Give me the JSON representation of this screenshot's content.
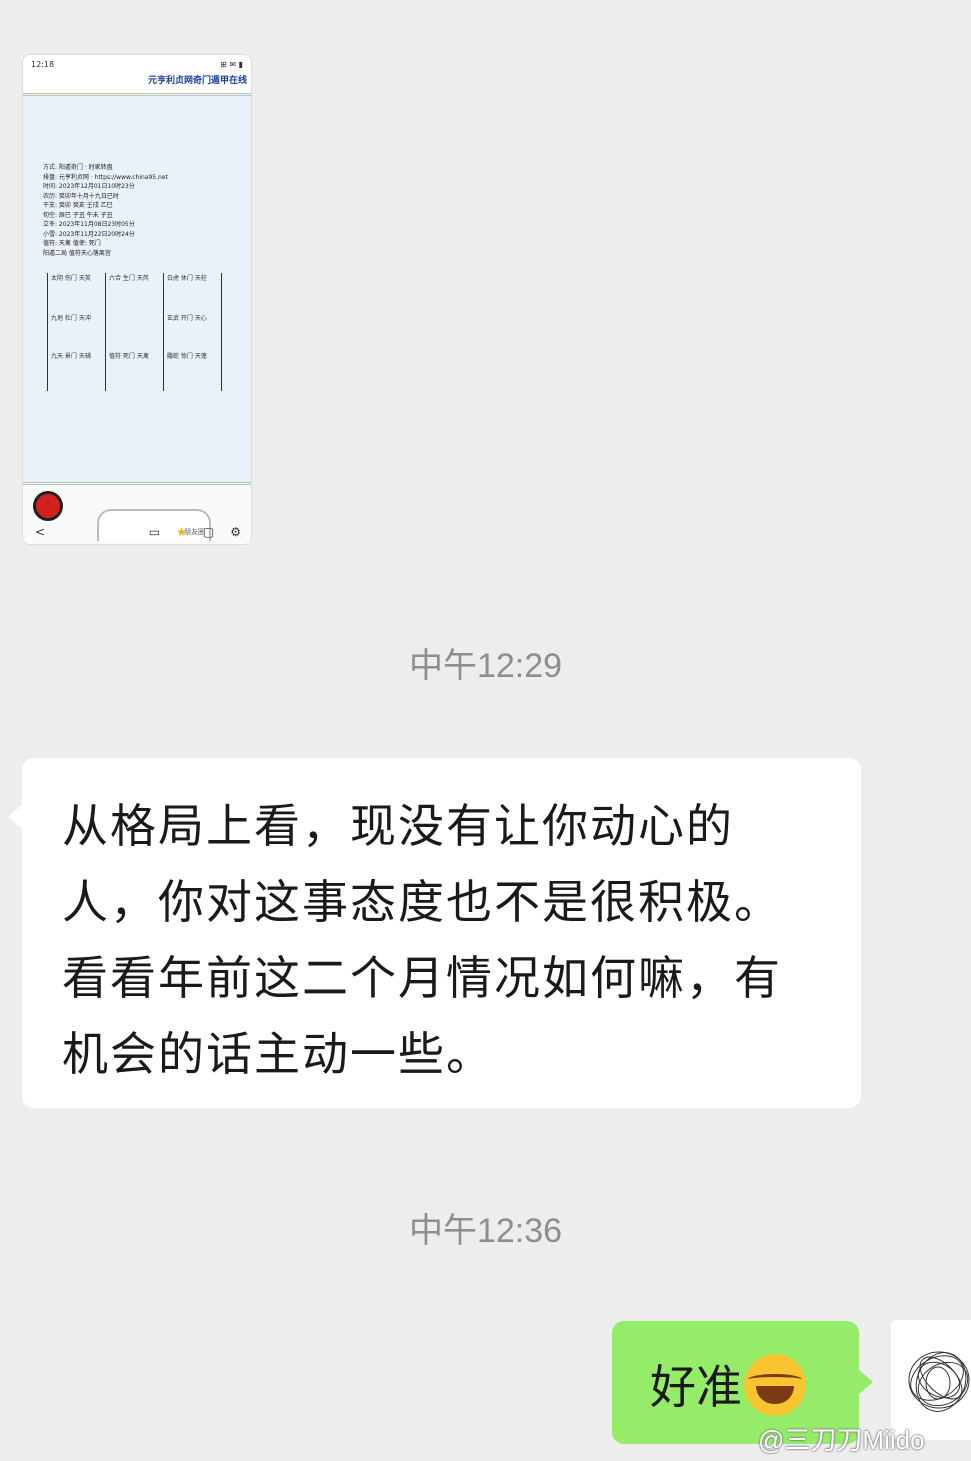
{
  "thumbnail": {
    "status_time": "12:18",
    "status_icons": "⊞ ✉ ▮",
    "title": "元亨利贞网奇门遁甲在线",
    "info_lines": [
      "方式: 阳遁奇门 · 时家转盘",
      "排盘: 元亨利贞网 · https://www.china95.net",
      "时间: 2023年12月01日10时23分",
      "农历: 癸卯年十月十九日巳时",
      "干支: 癸卯  癸亥  壬戌  乙巳",
      "旬空: 辰巳  子丑  午未  子丑",
      "立冬: 2023年11月08日23时05分",
      "小雪: 2023年11月22日20时24分",
      "值符: 天禽  值使: 死门",
      "阳遁二局  值符天心落离宫"
    ],
    "grid": [
      [
        "太阴 伤门 天英",
        "六合 生门 天芮",
        "白虎 休门 天柱"
      ],
      [
        "九地 杜门 天冲",
        "",
        "玄武 开门 天心"
      ],
      [
        "九天 景门 天辅",
        "值符 死门 天禽",
        "螣蛇 惊门 天蓬"
      ]
    ],
    "nav_back": "<",
    "bubble_badge": "朋友圈"
  },
  "messages": [
    {
      "type": "time",
      "text": "中午12:29"
    },
    {
      "type": "received",
      "lines": [
        "从格局上看，现没有让你动心的",
        "人，你对这事态度也不是很积极。",
        "看看年前这二个月情况如何嘛，有",
        "机会的话主动一些。"
      ]
    },
    {
      "type": "time",
      "text": "中午12:36"
    },
    {
      "type": "sent",
      "text": "好准",
      "emoji": "face-with-tears-of-joy"
    }
  ],
  "watermark": "@三刀刀Miido",
  "colors": {
    "background": "#ededed",
    "sent_bubble": "#95ec69",
    "received_bubble": "#ffffff",
    "time_text": "#8e8e8e"
  }
}
